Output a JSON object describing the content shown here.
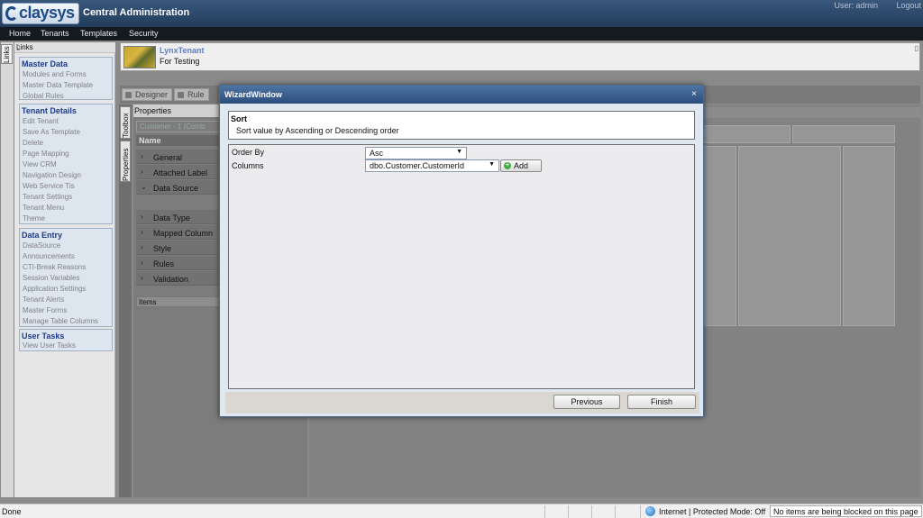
{
  "header": {
    "logo_text": "claysys",
    "app_title": "Central Administration",
    "user": "User: admin",
    "logout": "Logout"
  },
  "nav": [
    "Home",
    "Tenants",
    "Templates",
    "Security"
  ],
  "links_tab": "Links",
  "links_panel": {
    "title": "Links",
    "groups": [
      {
        "title": "Master Data",
        "items": [
          "Modules and Forms",
          "Master Data Template",
          "Global Rules"
        ]
      },
      {
        "title": "Tenant Details",
        "items": [
          "Edit Tenant",
          "Save As Template",
          "Delete",
          "Page Mapping",
          "View CRM",
          "Navigation Design",
          "Web Service Tis",
          "Tenant Settings",
          "Tenant Menu",
          "Theme"
        ]
      },
      {
        "title": "Data Entry",
        "items": [
          "DataSource",
          "Announcements",
          "CTI-Break Reasons",
          "Session Variables",
          "Application Settings",
          "Tenant Alerts",
          "Master Forms",
          "Manage Table Columns"
        ]
      },
      {
        "title": "User Tasks",
        "items": [
          "View User Tasks"
        ]
      }
    ]
  },
  "tenant": {
    "name": "LynxTenant",
    "description": "For Testing"
  },
  "toolbar": {
    "designer": "Designer",
    "rule": "Rule"
  },
  "side_tabs": {
    "toolbox": "Toolbox",
    "properties": "Properties"
  },
  "properties": {
    "header": "Properties",
    "selected": "Customer - 1 (Comb",
    "name_header": "Name",
    "rows": [
      "General",
      "Attached Label",
      "Data Source",
      "Data Type",
      "Mapped Column",
      "Style",
      "Rules",
      "Validation"
    ],
    "items_label": "Items"
  },
  "wizard": {
    "title": "WizardWindow",
    "close": "×",
    "step_title": "Sort",
    "step_description": "Sort value by Ascending or Descending order",
    "order_by_label": "Order By",
    "order_by_value": "Asc",
    "columns_label": "Columns",
    "columns_value": "dbo.Customer.CustomerId",
    "add_label": "Add",
    "previous_label": "Previous",
    "finish_label": "Finish"
  },
  "status": {
    "left": "Done",
    "zone": "Internet | Protected Mode: Off",
    "blocked": "No items are being blocked on this page"
  }
}
